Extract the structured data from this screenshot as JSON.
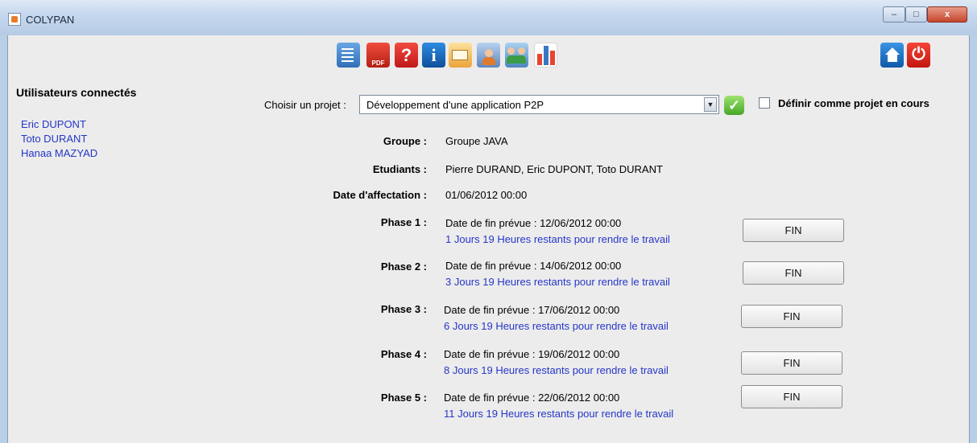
{
  "window": {
    "title": "COLYPAN",
    "minimize_label": "–",
    "maximize_label": "□",
    "close_label": "x"
  },
  "toolbar": {
    "icons": [
      "list-icon",
      "pdf-icon",
      "help-icon",
      "info-icon",
      "mail-icon",
      "user-icon",
      "group-settings-icon",
      "chart-icon",
      "home-icon",
      "power-icon"
    ],
    "pdf_text": "PDF",
    "help_text": "?",
    "info_text": "i",
    "power_text": "⏻"
  },
  "sidebar": {
    "title": "Utilisateurs connectés",
    "users": [
      "Eric DUPONT",
      "Toto DURANT",
      "Hanaa MAZYAD"
    ]
  },
  "project": {
    "choose_label": "Choisir un projet :",
    "selected": "Développement d'une application P2P",
    "dropdown_arrow": "▼",
    "validate_glyph": "✓",
    "set_current_label": "Définir comme projet en cours"
  },
  "details": {
    "group_label": "Groupe :",
    "group_value": "Groupe JAVA",
    "students_label": "Etudiants :",
    "students_value": "Pierre DURAND, Eric DUPONT, Toto DURANT",
    "assign_label": "Date d'affectation :",
    "assign_value": "01/06/2012 00:00"
  },
  "phases": [
    {
      "label": "Phase 1 :",
      "due": "Date de fin prévue : 12/06/2012 00:00",
      "remaining": "1 Jours 19 Heures restants pour rendre le travail",
      "button": "FIN"
    },
    {
      "label": "Phase 2 :",
      "due": "Date de fin prévue : 14/06/2012 00:00",
      "remaining": "3 Jours 19 Heures restants pour rendre le travail",
      "button": "FIN"
    },
    {
      "label": "Phase 3 :",
      "due": "Date de fin prévue : 17/06/2012 00:00",
      "remaining": "6 Jours 19 Heures restants pour rendre le travail",
      "button": "FIN"
    },
    {
      "label": "Phase 4 :",
      "due": "Date de fin prévue : 19/06/2012 00:00",
      "remaining": "8 Jours 19 Heures restants pour rendre le travail",
      "button": "FIN"
    },
    {
      "label": "Phase 5 :",
      "due": "Date de fin prévue : 22/06/2012 00:00",
      "remaining": "11 Jours 19 Heures restants pour rendre le travail",
      "button": "FIN"
    }
  ],
  "colors": {
    "link_blue": "#2536c8",
    "window_frame": "#b9cfe7",
    "panel_bg": "#ececec"
  }
}
